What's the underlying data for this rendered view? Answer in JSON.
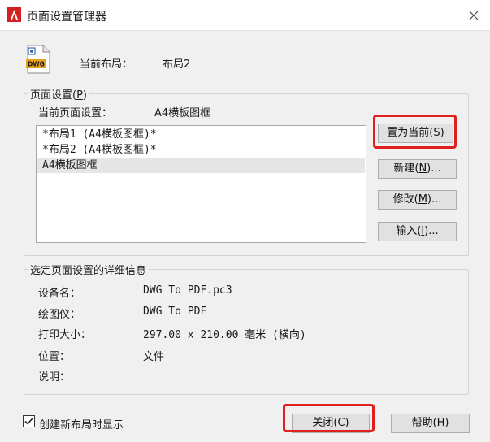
{
  "window": {
    "title": "页面设置管理器",
    "close_glyph": "✕"
  },
  "header": {
    "icon_label": "DWG",
    "current_layout_label": "当前布局：",
    "current_layout_value": "布局2"
  },
  "page_setup_group": {
    "legend": "页面设置(P)",
    "current_setup_label": "当前页面设置：",
    "current_setup_value": "A4横板图框",
    "list": [
      {
        "text": "*布局1 (A4横板图框)*",
        "selected": false
      },
      {
        "text": "*布局2 (A4横板图框)*",
        "selected": false
      },
      {
        "text": "A4横板图框",
        "selected": true
      }
    ],
    "buttons": {
      "set_current": "置为当前(S)",
      "new": "新建(N)...",
      "modify": "修改(M)...",
      "import": "输入(I)..."
    }
  },
  "details_group": {
    "legend": "选定页面设置的详细信息",
    "rows": [
      {
        "label": "设备名：",
        "value": "DWG To PDF.pc3"
      },
      {
        "label": "绘图仪：",
        "value": "DWG To PDF"
      },
      {
        "label": "打印大小：",
        "value": "297.00 x 210.00 毫米 (横向)"
      },
      {
        "label": "位置：",
        "value": "文件"
      },
      {
        "label": "说明：",
        "value": ""
      }
    ]
  },
  "footer": {
    "checkbox_label": "创建新布局时显示",
    "checkbox_checked": true,
    "close_button": "关闭(C)",
    "help_button": "帮助(H)"
  },
  "colors": {
    "highlight": "#e02020",
    "app_icon_red": "#d42020",
    "dialog_bg": "#f0f0f0"
  },
  "icons": [
    "autocad-app-icon",
    "dwg-file-icon",
    "close-icon",
    "checkmark-icon"
  ]
}
